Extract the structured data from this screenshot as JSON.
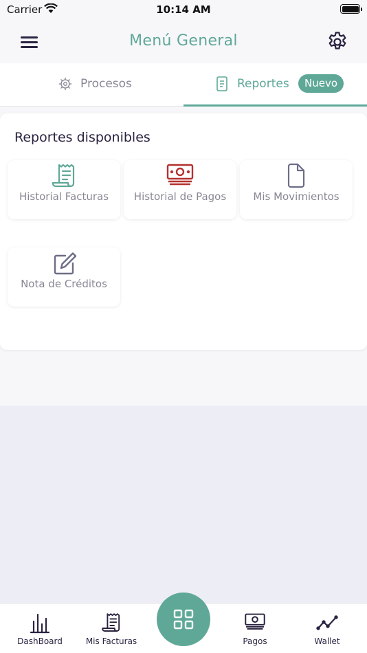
{
  "status_bar": {
    "carrier": "Carrier",
    "time": "10:14 AM"
  },
  "header": {
    "title": "Menú General"
  },
  "tabs": [
    {
      "label": "Procesos",
      "icon": "gear-icon",
      "active": false
    },
    {
      "label": "Reportes",
      "icon": "document-icon",
      "active": true,
      "badge": "Nuevo"
    }
  ],
  "reports": {
    "title": "Reportes disponibles",
    "items": [
      {
        "label": "Historial Facturas",
        "icon": "receipt-icon",
        "color": "#5fa898"
      },
      {
        "label": "Historial de Pagos",
        "icon": "cash-icon",
        "color": "#b3312f"
      },
      {
        "label": "Mis Movimientos",
        "icon": "file-icon",
        "color": "#6c6e86"
      },
      {
        "label": "Nota de Créditos",
        "icon": "edit-icon",
        "color": "#6c6e86"
      }
    ]
  },
  "bottom_nav": {
    "items": [
      {
        "label": "DashBoard",
        "icon": "bar-chart-icon"
      },
      {
        "label": "Mis Facturas",
        "icon": "receipt-icon"
      },
      {
        "label": "Pagos",
        "icon": "cash-icon"
      },
      {
        "label": "Wallet",
        "icon": "trend-line-icon"
      }
    ],
    "center_icon": "grid-icon"
  },
  "colors": {
    "accent": "#5fa898",
    "text": "#2a2340",
    "muted": "#8a8794",
    "background": "#ededf5"
  }
}
